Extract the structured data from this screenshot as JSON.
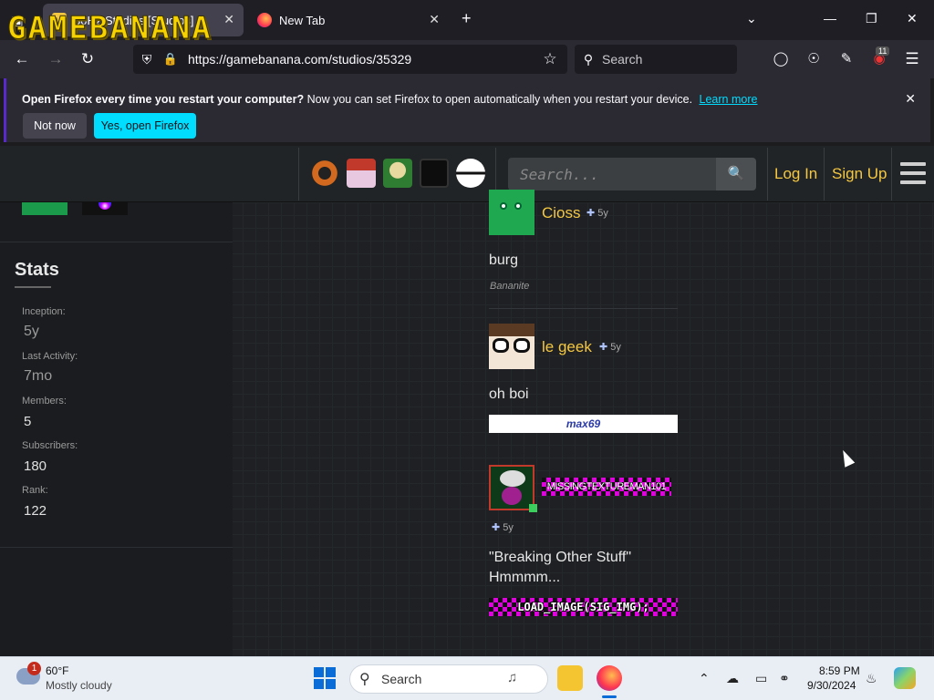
{
  "browser": {
    "tabs": [
      {
        "title": "30Hz Studios [Studios]"
      },
      {
        "title": "New Tab"
      }
    ],
    "url": "https://gamebanana.com/studios/35329",
    "search_placeholder": "Search",
    "extensions_badge": "11"
  },
  "notification": {
    "bold": "Open Firefox every time you restart your computer?",
    "text": "Now you can set Firefox to open automatically when you restart your device.",
    "learn_more": "Learn more",
    "not_now": "Not now",
    "yes_open": "Yes, open Firefox"
  },
  "site": {
    "logo": "GAMEBANANA",
    "search_placeholder": "Search...",
    "login": "Log In",
    "signup": "Sign Up"
  },
  "stats": {
    "title": "Stats",
    "items": [
      {
        "label": "Inception:",
        "value": "5y"
      },
      {
        "label": "Last Activity:",
        "value": "7mo"
      },
      {
        "label": "Members:",
        "value": "5"
      },
      {
        "label": "Subscribers:",
        "value": "180"
      },
      {
        "label": "Rank:",
        "value": "122"
      }
    ]
  },
  "posts": [
    {
      "user": "Cioss",
      "age": "5y",
      "message": "burg",
      "rank": "Bananite"
    },
    {
      "user": "le geek",
      "age": "5y",
      "message": "oh boi",
      "signature": "max69"
    },
    {
      "user": "MISSINGTEXTUREMAN101",
      "age": "5y",
      "message": "\"Breaking Other Stuff\" Hmmmm...",
      "signature": "LOAD_IMAGE(SIG_IMG);"
    }
  ],
  "taskbar": {
    "weather_badge": "1",
    "temp": "60°F",
    "condition": "Mostly cloudy",
    "search": "Search",
    "time": "8:59 PM",
    "date": "9/30/2024"
  }
}
